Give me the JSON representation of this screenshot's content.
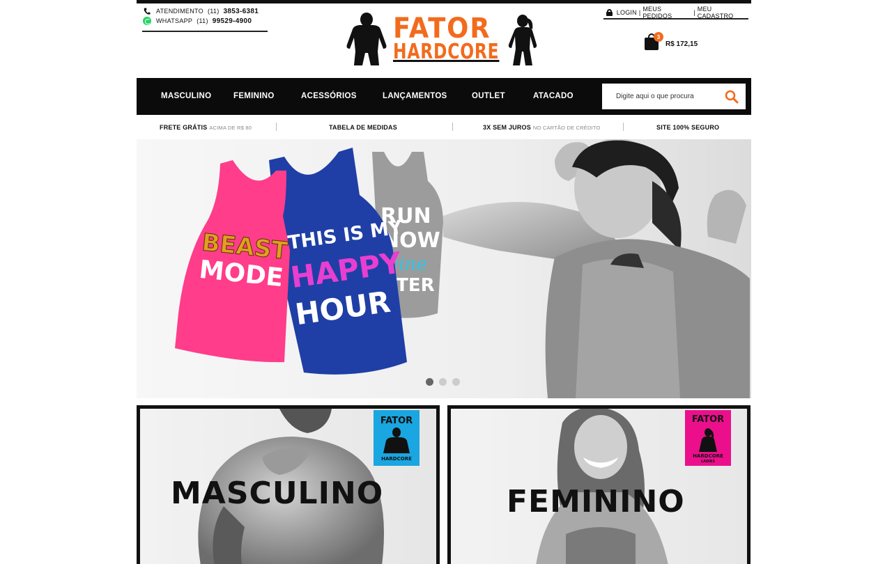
{
  "contact": {
    "phone_label": "ATENDIMENTO",
    "phone_area": "(11)",
    "phone_number": "3853-6381",
    "whatsapp_label": "WHATSAPP",
    "whatsapp_area": "(11)",
    "whatsapp_number": "99529-4900"
  },
  "logo": {
    "line1": "FATOR",
    "line2": "HARDCORE"
  },
  "account": {
    "login": "LOGIN",
    "orders": "MEUS PEDIDOS",
    "register": "MEU CADASTRO",
    "separator": "|"
  },
  "cart": {
    "count": "3",
    "total": "R$ 172,15"
  },
  "nav": {
    "items": [
      "MASCULINO",
      "FEMININO",
      "ACESSÓRIOS",
      "LANÇAMENTOS",
      "OUTLET",
      "ATACADO"
    ],
    "search_placeholder": "Digite aqui o que procura"
  },
  "benefits": [
    {
      "bold": "FRETE GRÁTIS",
      "muted": "ACIMA DE R$ 80"
    },
    {
      "bold": "TABELA DE MEDIDAS",
      "muted": ""
    },
    {
      "bold": "3X SEM JUROS",
      "muted": "NO CARTÃO DE CRÉDITO"
    },
    {
      "bold": "SITE 100% SEGURO",
      "muted": ""
    }
  ],
  "banner": {
    "shirt_pink_line1": "BEAST",
    "shirt_pink_line2": "MODE",
    "shirt_blue_line1": "THIS IS MY",
    "shirt_blue_line2": "HAPPY",
    "shirt_blue_line3": "HOUR",
    "shirt_gray_line1": "RUN",
    "shirt_gray_line2": "NOW",
    "shirt_gray_line3": "wine",
    "shirt_gray_line4": "ATER",
    "slides": 3,
    "active_slide": 1
  },
  "categories": [
    {
      "title": "MASCULINO",
      "badge_top": "FATOR",
      "badge_bottom": "HARDCORE",
      "badge_color": "#1aa6e0"
    },
    {
      "title": "FEMININO",
      "badge_top": "FATOR",
      "badge_bottom": "HARDCORE",
      "badge_sub": "LADIES",
      "badge_color": "#ec0f8c"
    }
  ],
  "colors": {
    "brand_orange": "#f26b1d",
    "nav_bg": "#0b0b0b"
  }
}
